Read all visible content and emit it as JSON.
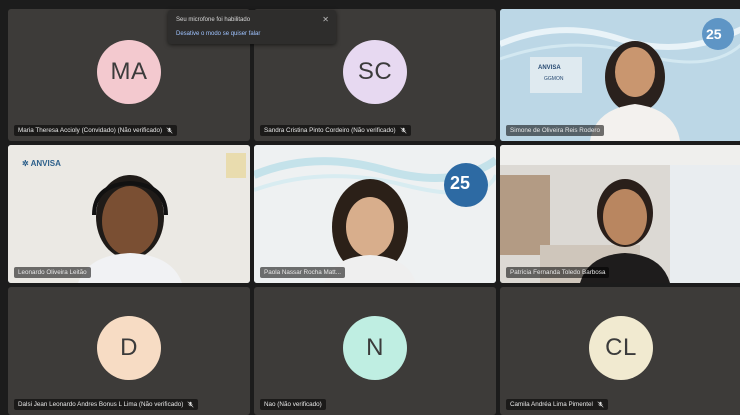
{
  "toast": {
    "title": "Seu microfone foi habilitado",
    "action": "Desative o modo se quiser falar",
    "close_icon": "close-icon"
  },
  "tiles": [
    {
      "initials": "MA",
      "avatar_color": "#f3c9cf",
      "name": "Maria Theresa Accioly (Convidado) (Não verificado)",
      "video": false
    },
    {
      "initials": "SC",
      "avatar_color": "#e7d9f1",
      "name": "Sandra Cristina Pinto Cordeiro (Não verificado)",
      "video": false
    },
    {
      "initials": "",
      "avatar_color": "",
      "name": "Simone de Oliveira Reis Rodero",
      "video": true,
      "background_text": "ANVISA GGMON",
      "badge": "25"
    },
    {
      "initials": "",
      "avatar_color": "",
      "name": "Leonardo Oliveira Leitão",
      "video": true,
      "background_text": "ANVISA"
    },
    {
      "initials": "",
      "avatar_color": "",
      "name": "Paola Nassar Rocha Matt...",
      "video": true,
      "badge": "25"
    },
    {
      "initials": "",
      "avatar_color": "",
      "name": "Patrícia Fernanda Toledo Barbosa",
      "video": true
    },
    {
      "initials": "D",
      "avatar_color": "#f7dcc4",
      "name": "Dalsi Jean Leonardo Andres Bonus L Lima (Não verificado)",
      "video": false
    },
    {
      "initials": "N",
      "avatar_color": "#bfeee2",
      "name": "Nao (Não verificado)",
      "video": false
    },
    {
      "initials": "CL",
      "avatar_color": "#f1ead0",
      "name": "Camila Andréa Lima Pimentel",
      "video": false
    }
  ]
}
